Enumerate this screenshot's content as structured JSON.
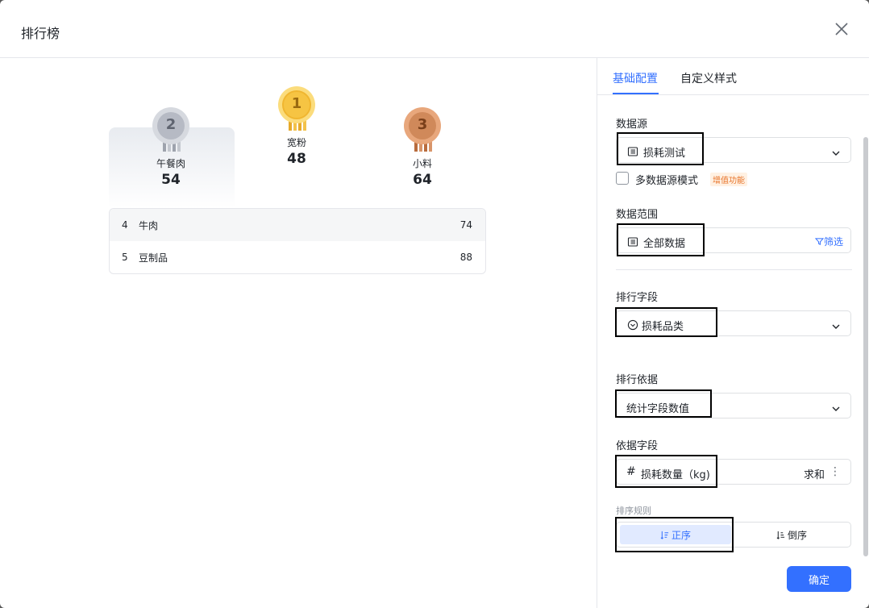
{
  "dialog": {
    "title": "排行榜",
    "close_icon": "close-icon"
  },
  "leaderboard": {
    "top3": [
      {
        "rank": "1",
        "name": "宽粉",
        "value": "48",
        "medal": "gold",
        "color": "#f6c443"
      },
      {
        "rank": "2",
        "name": "午餐肉",
        "value": "54",
        "medal": "silver",
        "color": "#b6bac4"
      },
      {
        "rank": "3",
        "name": "小料",
        "value": "64",
        "medal": "bronze",
        "color": "#d0895a"
      }
    ],
    "rows": [
      {
        "idx": "4",
        "name": "牛肉",
        "value": "74"
      },
      {
        "idx": "5",
        "name": "豆制品",
        "value": "88"
      }
    ]
  },
  "panel": {
    "tabs": [
      {
        "label": "基础配置",
        "active": true
      },
      {
        "label": "自定义样式",
        "active": false
      }
    ],
    "datasource": {
      "label": "数据源",
      "value": "损耗测试",
      "icon": "table-icon"
    },
    "multi_source": {
      "label": "多数据源模式",
      "badge": "增值功能",
      "checked": false
    },
    "data_range": {
      "label": "数据范围",
      "value": "全部数据",
      "filter": "筛选",
      "icon": "table-icon"
    },
    "rank_field": {
      "label": "排行字段",
      "value": "损耗品类",
      "icon": "dropdown-circle-icon"
    },
    "rank_basis": {
      "label": "排行依据",
      "value": "统计字段数值"
    },
    "basis_field": {
      "label": "依据字段",
      "value": "损耗数量（kg)",
      "hash": "#",
      "agg": "求和",
      "more": "⋮"
    },
    "sort_rule": {
      "label": "排序规则",
      "asc": "正序",
      "desc": "倒序"
    },
    "confirm": "确定"
  },
  "colors": {
    "accent": "#3370ff",
    "border": "#dee0e3"
  }
}
